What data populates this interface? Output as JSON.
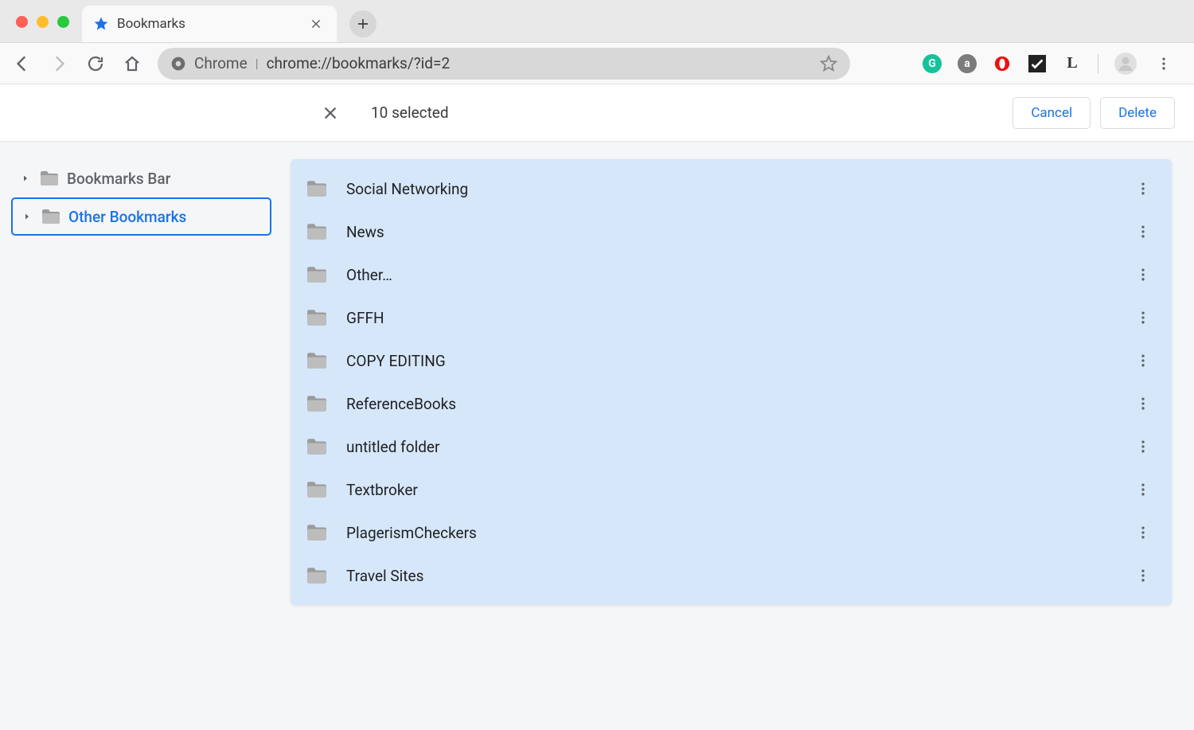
{
  "window": {
    "tab_title": "Bookmarks"
  },
  "address_bar": {
    "scheme": "Chrome",
    "url_path": "chrome://bookmarks/?id=2"
  },
  "extensions": {
    "grammarly": "G",
    "amazon": "a",
    "lastpass": "L"
  },
  "selection": {
    "count_text": "10 selected",
    "cancel_label": "Cancel",
    "delete_label": "Delete"
  },
  "sidebar": {
    "items": [
      {
        "label": "Bookmarks Bar",
        "selected": false
      },
      {
        "label": "Other Bookmarks",
        "selected": true
      }
    ]
  },
  "bookmarks": [
    {
      "name": "Social Networking"
    },
    {
      "name": "News"
    },
    {
      "name": "Other…"
    },
    {
      "name": "GFFH"
    },
    {
      "name": "COPY EDITING"
    },
    {
      "name": "ReferenceBooks"
    },
    {
      "name": "untitled folder"
    },
    {
      "name": "Textbroker"
    },
    {
      "name": "PlagerismCheckers"
    },
    {
      "name": "Travel Sites"
    }
  ]
}
